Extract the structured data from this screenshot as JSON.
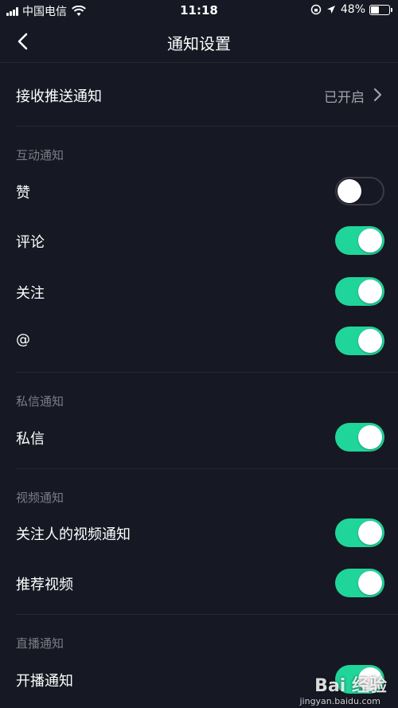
{
  "status_bar": {
    "carrier": "中国电信",
    "time": "11:18",
    "battery_text": "48%",
    "battery_level": 0.48
  },
  "header": {
    "title": "通知设置"
  },
  "push": {
    "label": "接收推送通知",
    "value": "已开启"
  },
  "sections": {
    "interaction": {
      "title": "互动通知",
      "items": [
        {
          "label": "赞",
          "enabled": false
        },
        {
          "label": "评论",
          "enabled": true
        },
        {
          "label": "关注",
          "enabled": true
        },
        {
          "label": "@",
          "enabled": true
        }
      ]
    },
    "message": {
      "title": "私信通知",
      "items": [
        {
          "label": "私信",
          "enabled": true
        }
      ]
    },
    "video": {
      "title": "视频通知",
      "items": [
        {
          "label": "关注人的视频通知",
          "enabled": true
        },
        {
          "label": "推荐视频",
          "enabled": true
        }
      ]
    },
    "live": {
      "title": "直播通知",
      "items": [
        {
          "label": "开播通知",
          "enabled": true
        }
      ]
    }
  },
  "colors": {
    "background": "#161823",
    "toggle_on": "#20d59a",
    "divider": "#26272f"
  },
  "watermark": {
    "brand": "Bai 经验",
    "url": "jingyan.baidu.com"
  }
}
